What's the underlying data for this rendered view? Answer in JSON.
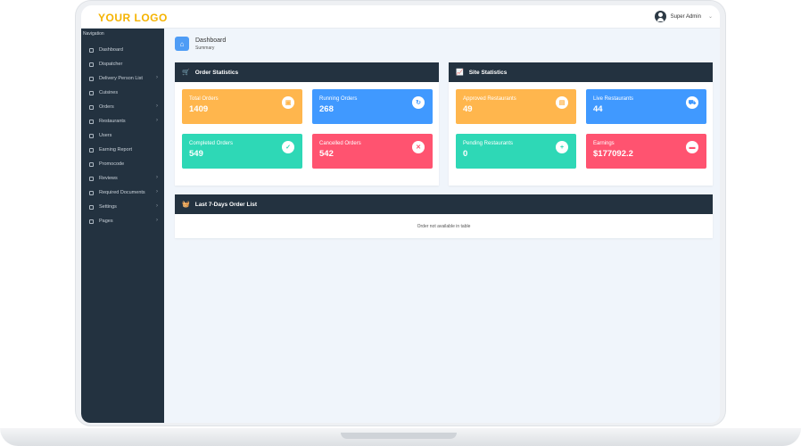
{
  "header": {
    "logo": "YOUR LOGO",
    "user_name": "Super Admin"
  },
  "sidebar": {
    "heading": "Navigation",
    "items": [
      {
        "label": "Dashboard",
        "icon": "home-icon",
        "has_submenu": false
      },
      {
        "label": "Dispatcher",
        "icon": "dispatch-icon",
        "has_submenu": false
      },
      {
        "label": "Delivery Person List",
        "icon": "delivery-icon",
        "has_submenu": true
      },
      {
        "label": "Cuisines",
        "icon": "cuisine-icon",
        "has_submenu": false
      },
      {
        "label": "Orders",
        "icon": "orders-icon",
        "has_submenu": true
      },
      {
        "label": "Restaurants",
        "icon": "restaurant-icon",
        "has_submenu": true
      },
      {
        "label": "Users",
        "icon": "users-icon",
        "has_submenu": false
      },
      {
        "label": "Earning Report",
        "icon": "report-icon",
        "has_submenu": false
      },
      {
        "label": "Promocode",
        "icon": "promo-icon",
        "has_submenu": false
      },
      {
        "label": "Reviews",
        "icon": "reviews-icon",
        "has_submenu": true
      },
      {
        "label": "Required Documents",
        "icon": "documents-icon",
        "has_submenu": true
      },
      {
        "label": "Settings",
        "icon": "settings-icon",
        "has_submenu": true
      },
      {
        "label": "Pages",
        "icon": "pages-icon",
        "has_submenu": true
      }
    ]
  },
  "breadcrumb": {
    "title": "Dashboard",
    "subtitle": "Summary"
  },
  "order_stats": {
    "title": "Order Statistics",
    "cards": [
      {
        "label": "Total Orders",
        "value": "1409",
        "icon": "bag-icon"
      },
      {
        "label": "Running Orders",
        "value": "268",
        "icon": "refresh-icon"
      },
      {
        "label": "Completed Orders",
        "value": "549",
        "icon": "check-icon"
      },
      {
        "label": "Cancelled Orders",
        "value": "542",
        "icon": "close-icon"
      }
    ]
  },
  "site_stats": {
    "title": "Site Statistics",
    "cards": [
      {
        "label": "Approved Restaurants",
        "value": "49",
        "icon": "store-icon"
      },
      {
        "label": "Live Restaurants",
        "value": "44",
        "icon": "truck-icon"
      },
      {
        "label": "Pending Restaurants",
        "value": "0",
        "icon": "user-plus-icon"
      },
      {
        "label": "Earnings",
        "value": "$177092.2",
        "icon": "money-icon"
      }
    ]
  },
  "order_list": {
    "title": "Last 7-Days Order List",
    "empty_text": "Order not available in table"
  },
  "colors": {
    "sidebar": "#233240",
    "orange": "#ffb64d",
    "blue": "#4099ff",
    "green": "#2ed8b6",
    "red": "#ff5370",
    "logo": "#f5b300"
  }
}
